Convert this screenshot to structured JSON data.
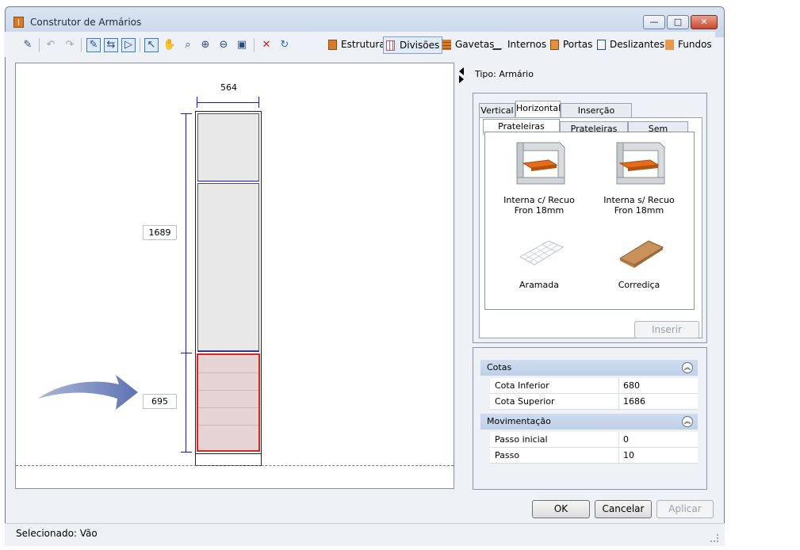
{
  "window": {
    "title": "Construtor de Armários"
  },
  "toolbar": {
    "icons": [
      "new-icon",
      "undo-icon",
      "redo-icon",
      "edit-line-icon",
      "move-icon",
      "resize-icon",
      "select-icon",
      "hand-icon",
      "zoom-extent-icon",
      "zoom-in-icon",
      "zoom-out-icon",
      "zoom-window-icon",
      "delete-icon",
      "refresh-icon"
    ],
    "tabs": [
      {
        "label": "Estrutura",
        "active": false
      },
      {
        "label": "Divisões",
        "active": true
      },
      {
        "label": "Gavetas",
        "active": false
      },
      {
        "label": "Internos",
        "active": false
      },
      {
        "label": "Portas",
        "active": false
      },
      {
        "label": "Deslizantes",
        "active": false
      },
      {
        "label": "Fundos",
        "active": false
      }
    ]
  },
  "drawing": {
    "width_dim": "564",
    "height_dim": "1689",
    "lower_dim": "695"
  },
  "panel": {
    "type_label": "Tipo: Armário",
    "tabs": [
      "Vertical",
      "Horizontal",
      "Inserção múltipla"
    ],
    "active_tab": "Horizontal",
    "subtabs": [
      "Prateleiras Móveis",
      "Prateleiras Fixas",
      "Sem Prateleira"
    ],
    "active_subtab": "Prateleiras Móveis",
    "items": [
      {
        "label": "Interna c/ Recuo Fron 18mm",
        "icon": "shelf-front-recess-icon"
      },
      {
        "label": "Interna s/ Recuo Fron 18mm",
        "icon": "shelf-no-recess-icon"
      },
      {
        "label": "Aramada",
        "icon": "wire-shelf-icon"
      },
      {
        "label": "Corrediça",
        "icon": "sliding-shelf-icon"
      }
    ],
    "insert_label": "Inserir"
  },
  "properties": {
    "groups": [
      {
        "title": "Cotas",
        "rows": [
          {
            "name": "Cota Inferior",
            "value": "680"
          },
          {
            "name": "Cota Superior",
            "value": "1686"
          }
        ]
      },
      {
        "title": "Movimentação",
        "rows": [
          {
            "name": "Passo inicial",
            "value": "0"
          },
          {
            "name": "Passo",
            "value": "10"
          }
        ]
      }
    ]
  },
  "buttons": {
    "ok": "OK",
    "cancel": "Cancelar",
    "apply": "Aplicar"
  },
  "status": {
    "text": "Selecionado: Vão"
  },
  "colors": {
    "accent": "#1717c8",
    "selection": "#d9251d",
    "selection_fill": "#e6d3d3",
    "panel_bg": "#e8e8e8"
  }
}
